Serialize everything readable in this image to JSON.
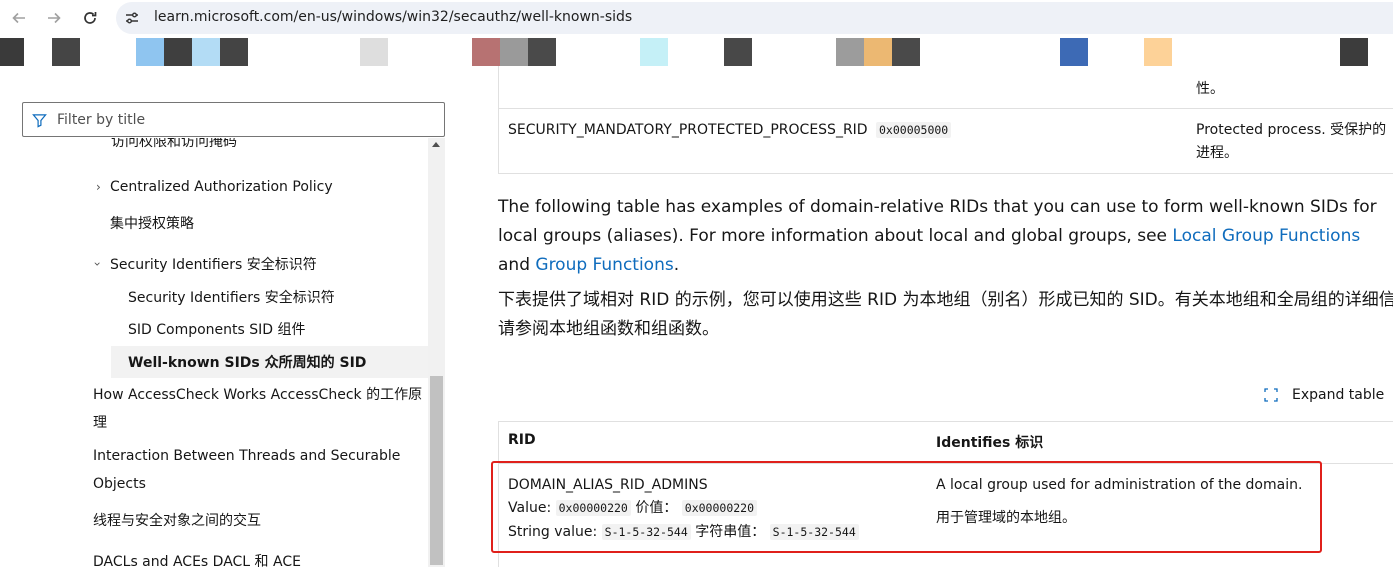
{
  "browser": {
    "url": "learn.microsoft.com/en-us/windows/win32/secauthz/well-known-sids",
    "bookmark_colors": [
      "#3a3a3a",
      "#454545",
      "#8fc5f0",
      "#3f3f3f",
      "#b3dcf5",
      "#444444",
      "#dedede",
      "#b77272",
      "#9a9a9a",
      "#4a4a4a",
      "#c5f0f7",
      "#484848",
      "#9c9c9c",
      "#ecb872",
      "#4a4a4a",
      "#3d6ab5",
      "#fdd298",
      "#3c3c3c"
    ]
  },
  "sidebar": {
    "filter_placeholder": "Filter by title",
    "items": {
      "cut_top": "访问权限和访问掩码",
      "central_auth": "Centralized Authorization Policy",
      "central_auth_cn": "集中授权策略",
      "security_identifiers": "Security Identifiers 安全标识符",
      "security_identifiers_child": "Security Identifiers 安全标识符",
      "sid_components": "SID Components SID 组件",
      "well_known": "Well-known SIDs 众所周知的 SID",
      "access_check": "How AccessCheck Works AccessCheck 的工作原理",
      "interaction": "Interaction Between Threads and Securable Objects",
      "interaction_cn": "线程与安全对象之间的交互",
      "dacls": "DACLs and ACEs DACL 和 ACE"
    }
  },
  "top_table": {
    "row0_desc_tail": "性。",
    "row1": {
      "name": "SECURITY_MANDATORY_PROTECTED_PROCESS_RID",
      "value": "0x00005000",
      "desc": "Protected process. 受保护的进程。"
    }
  },
  "content": {
    "para_en_1": "The following table has examples of domain-relative RIDs that you can use to form well-known SIDs for local groups (aliases). For more information about local and global groups, see ",
    "link_local": "Local Group Functions",
    "para_en_and": " and ",
    "link_group": "Group Functions",
    "para_en_end": ".",
    "para_cn": "下表提供了域相对 RID 的示例，您可以使用这些 RID 为本地组（别名）形成已知的 SID。有关本地组和全局组的详细信息，请参阅本地组函数和组函数。",
    "expand_label": "Expand table"
  },
  "rid_table": {
    "headers": [
      "RID",
      "Identifies 标识"
    ],
    "row": {
      "name": "DOMAIN_ALIAS_RID_ADMINS",
      "value_label": "Value:",
      "value_code": "0x00000220",
      "value_label_cn": "价值：",
      "value_code_cn": "0x00000220",
      "string_label": "String value:",
      "string_code": "S-1-5-32-544",
      "string_label_cn": "字符串值：",
      "string_code_cn": "S-1-5-32-544",
      "desc_en": "A local group used for administration of the domain.",
      "desc_cn": "用于管理域的本地组。"
    }
  }
}
